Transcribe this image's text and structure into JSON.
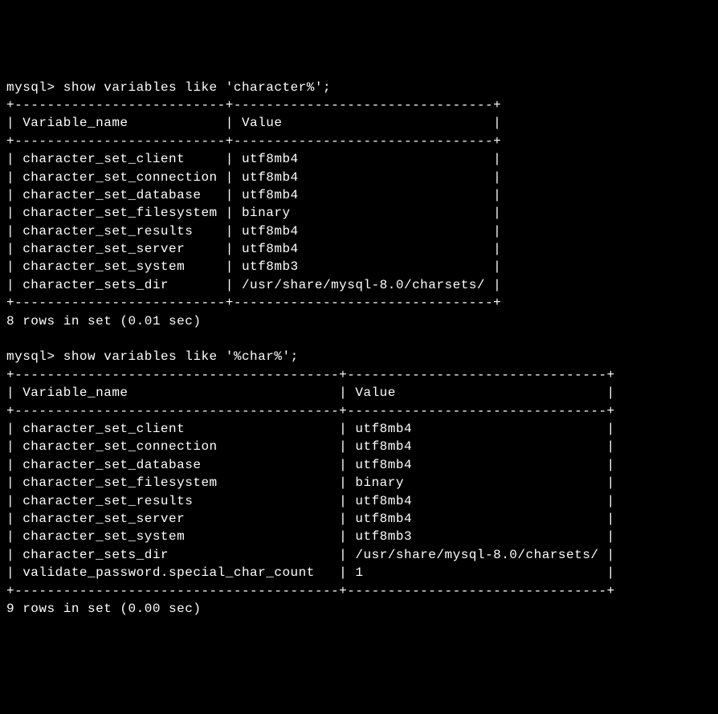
{
  "query1": {
    "prompt": "mysql> ",
    "command": "show variables like 'character%';",
    "headers": [
      "Variable_name",
      "Value"
    ],
    "rows": [
      [
        "character_set_client",
        "utf8mb4"
      ],
      [
        "character_set_connection",
        "utf8mb4"
      ],
      [
        "character_set_database",
        "utf8mb4"
      ],
      [
        "character_set_filesystem",
        "binary"
      ],
      [
        "character_set_results",
        "utf8mb4"
      ],
      [
        "character_set_server",
        "utf8mb4"
      ],
      [
        "character_set_system",
        "utf8mb3"
      ],
      [
        "character_sets_dir",
        "/usr/share/mysql-8.0/charsets/"
      ]
    ],
    "footer": "8 rows in set (0.01 sec)",
    "col1_width": 24,
    "col2_width": 30
  },
  "query2": {
    "prompt": "mysql> ",
    "command": "show variables like '%char%';",
    "headers": [
      "Variable_name",
      "Value"
    ],
    "rows": [
      [
        "character_set_client",
        "utf8mb4"
      ],
      [
        "character_set_connection",
        "utf8mb4"
      ],
      [
        "character_set_database",
        "utf8mb4"
      ],
      [
        "character_set_filesystem",
        "binary"
      ],
      [
        "character_set_results",
        "utf8mb4"
      ],
      [
        "character_set_server",
        "utf8mb4"
      ],
      [
        "character_set_system",
        "utf8mb3"
      ],
      [
        "character_sets_dir",
        "/usr/share/mysql-8.0/charsets/"
      ],
      [
        "validate_password.special_char_count",
        "1"
      ]
    ],
    "footer": "9 rows in set (0.00 sec)",
    "col1_width": 38,
    "col2_width": 30
  }
}
